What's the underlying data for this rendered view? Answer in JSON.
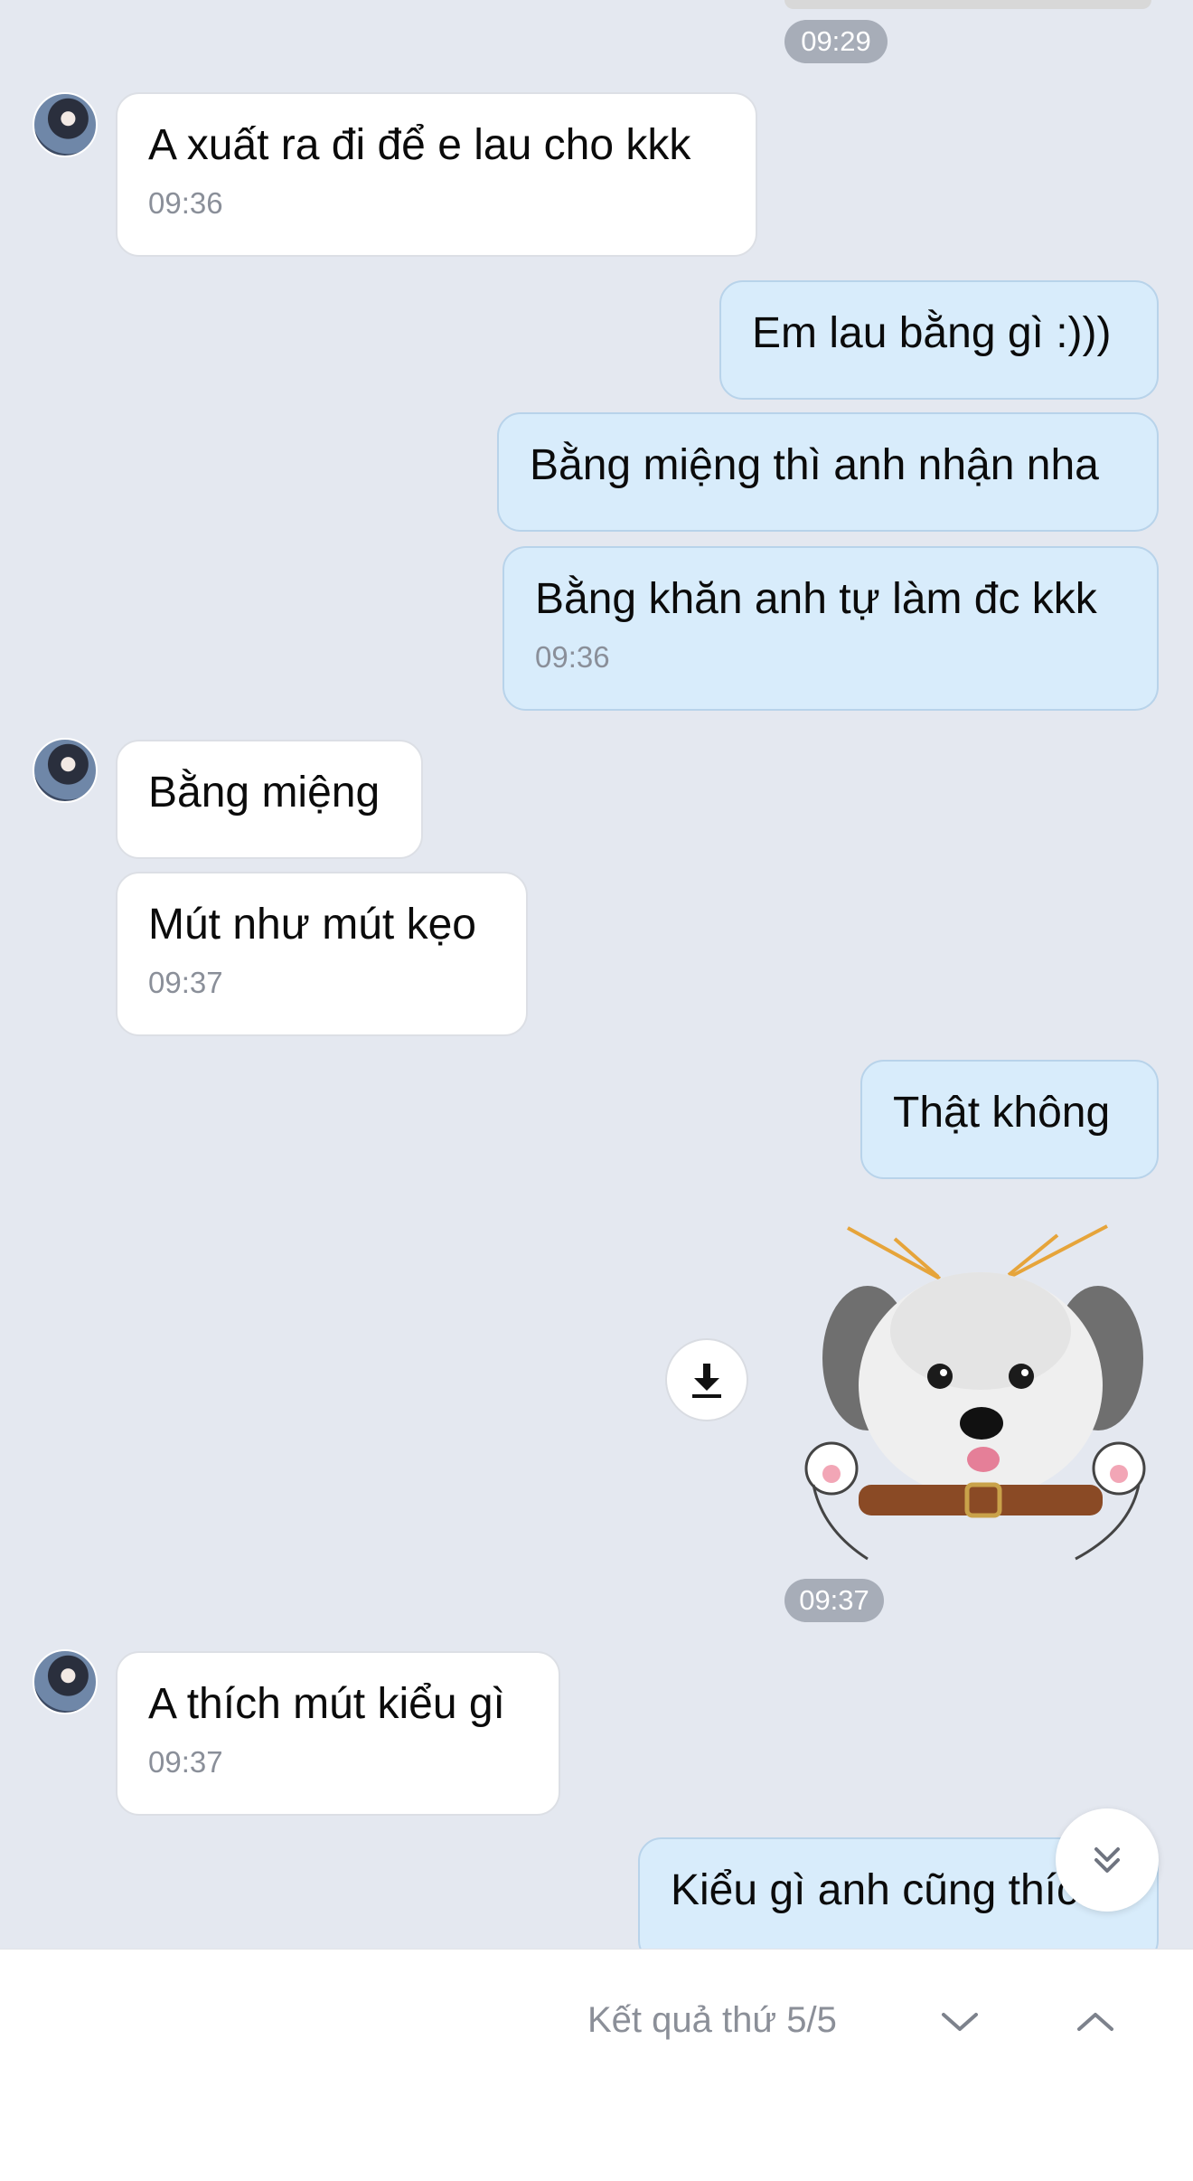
{
  "top": {
    "time": "09:29"
  },
  "messages": [
    {
      "text": "A xuất ra đi để e lau cho kkk",
      "time": "09:36"
    },
    {
      "text": "Em lau bằng gì :)))"
    },
    {
      "text": "Bằng miệng thì anh nhận nha"
    },
    {
      "text": "Bằng khăn anh tự làm đc kkk",
      "time": "09:36"
    },
    {
      "text": "Bằng miệng"
    },
    {
      "text": "Mút như mút kẹo",
      "time": "09:37"
    },
    {
      "text": "Thật không"
    },
    {
      "text": "A thích mút kiểu gì",
      "time": "09:37"
    },
    {
      "text": "Kiểu gì anh cũng thích"
    }
  ],
  "sticker": {
    "time": "09:37",
    "icon": "dog-sticker"
  },
  "search_bar": {
    "result_text": "Kết quả thứ 5/5"
  },
  "icons": {
    "download": "download-icon",
    "scroll_down": "double-chevron-down-icon",
    "next": "chevron-down-icon",
    "prev": "chevron-up-icon"
  },
  "colors": {
    "background": "#e4e8f0",
    "incoming_bubble": "#ffffff",
    "outgoing_bubble": "#d8ecfb",
    "time_pill": "#a7adb8"
  }
}
